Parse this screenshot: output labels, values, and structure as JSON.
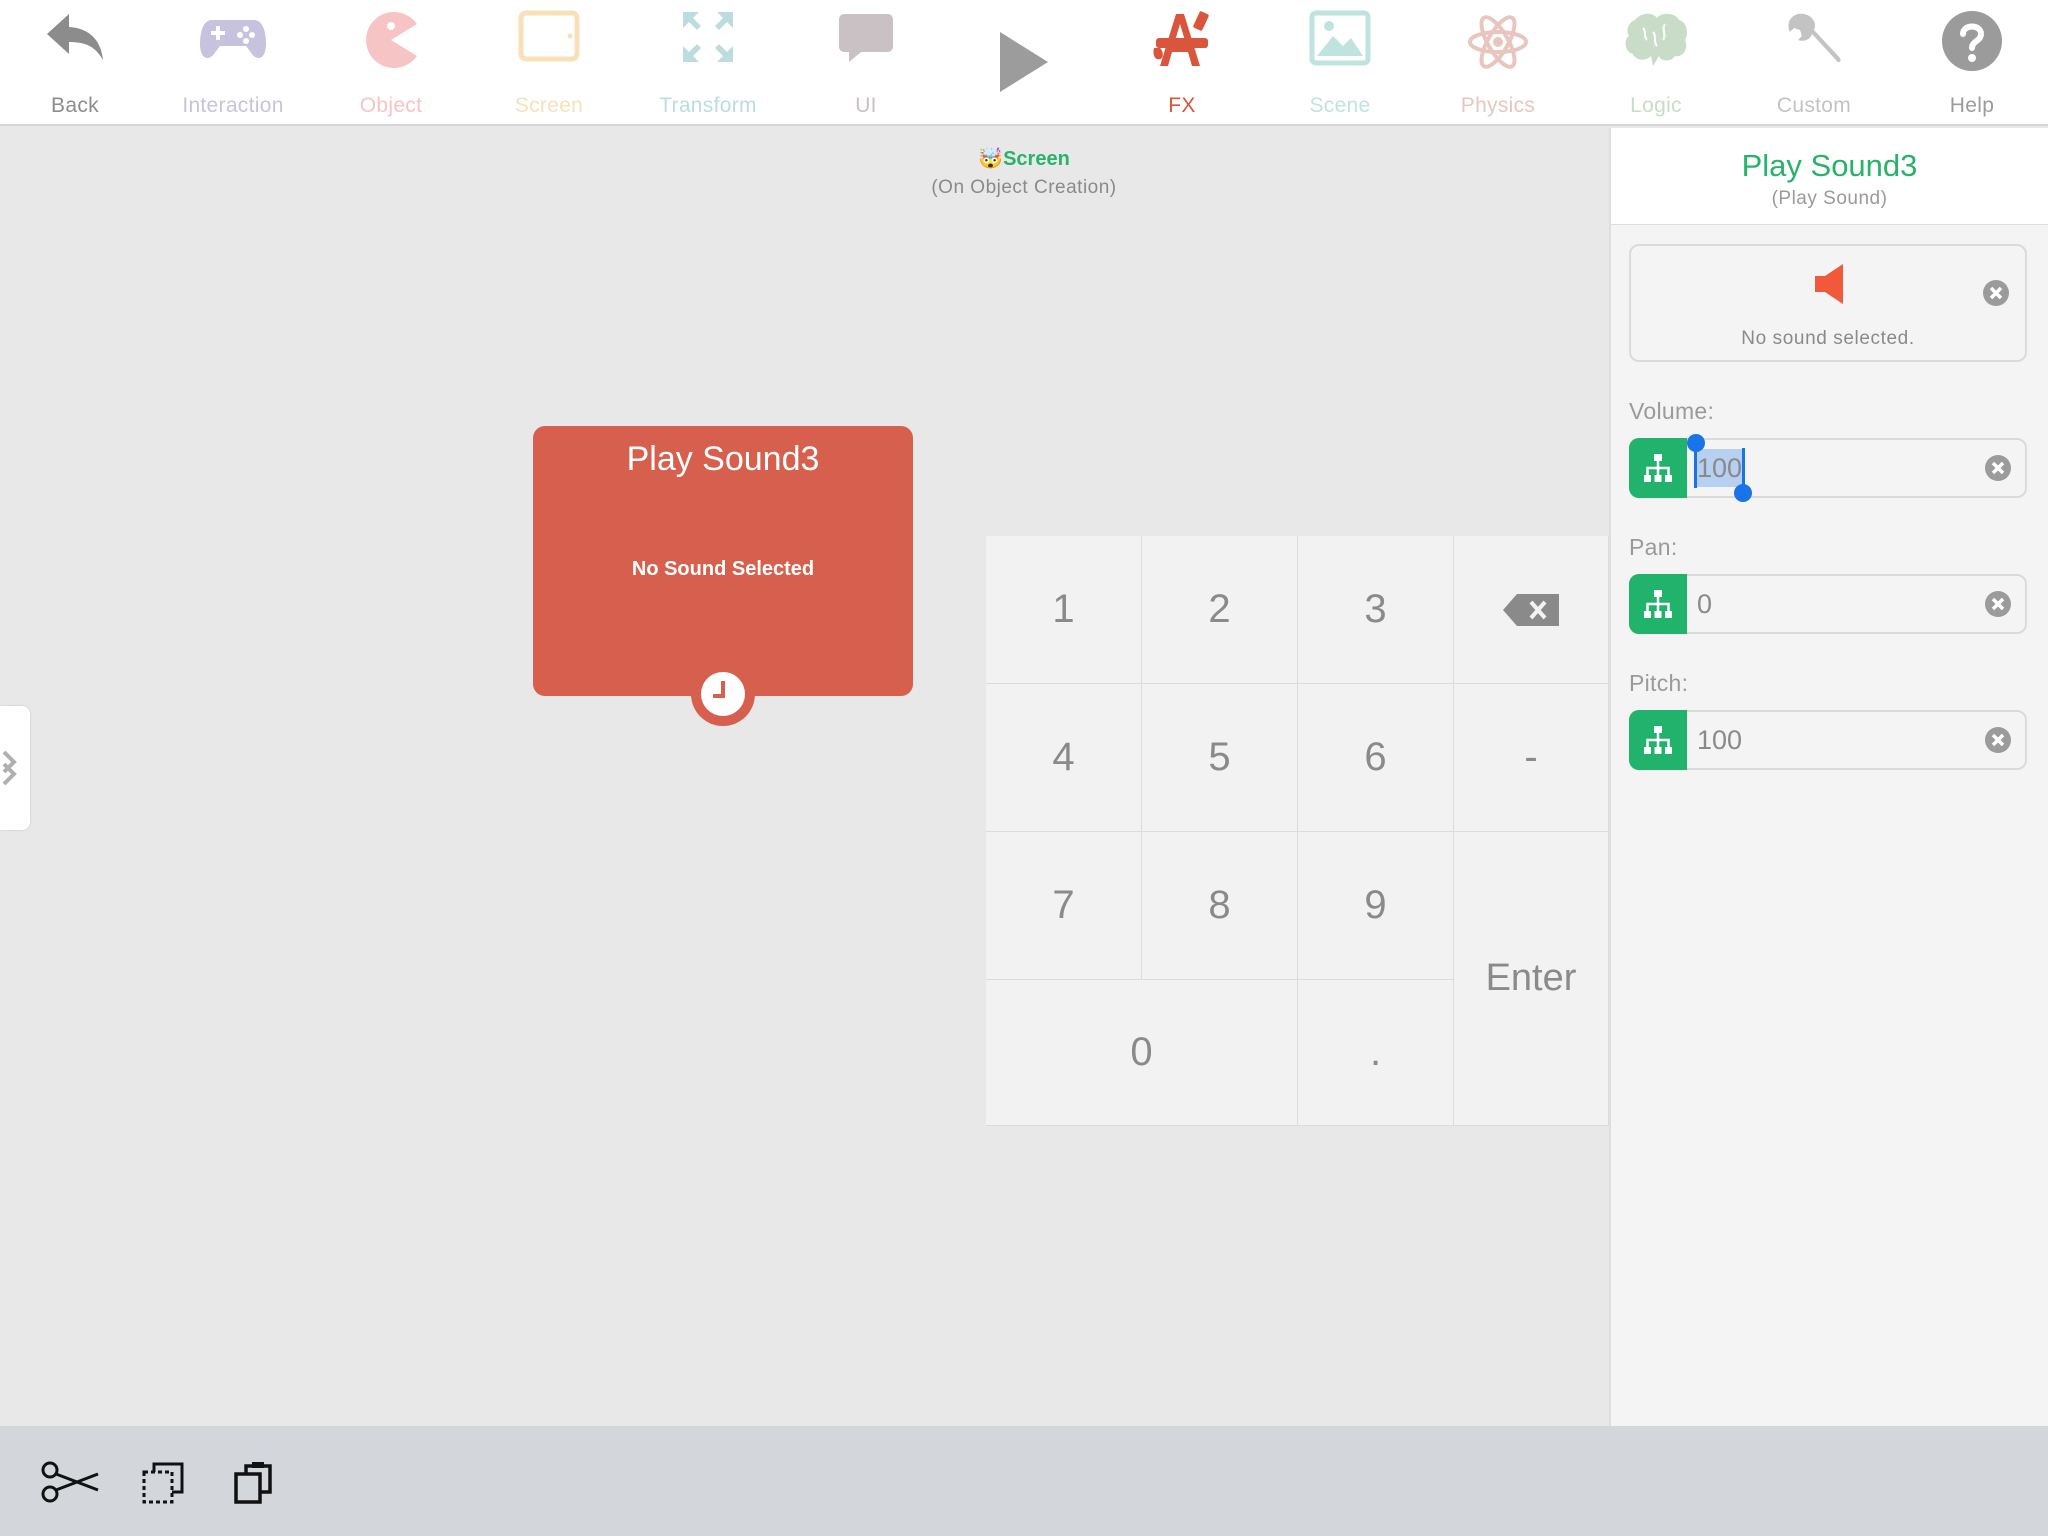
{
  "toolbar": {
    "items": [
      {
        "label": "Back",
        "icon": "back-arrow-icon",
        "color": "#8c8c8c"
      },
      {
        "label": "Interaction",
        "icon": "gamepad-icon",
        "color": "#c7c3df"
      },
      {
        "label": "Object",
        "icon": "pacman-icon",
        "color": "#f6c4c4"
      },
      {
        "label": "Screen",
        "icon": "tablet-icon",
        "color": "#f8e1b8"
      },
      {
        "label": "Transform",
        "icon": "expand-arrows-icon",
        "color": "#bcdcdf"
      },
      {
        "label": "UI",
        "icon": "speech-bubble-icon",
        "color": "#c9c1c3"
      },
      {
        "label": "",
        "icon": "play-icon",
        "color": "#9c9c9c"
      },
      {
        "label": "FX",
        "icon": "fx-brush-icon",
        "color": "#d9553b"
      },
      {
        "label": "Scene",
        "icon": "image-icon",
        "color": "#bfe3df"
      },
      {
        "label": "Physics",
        "icon": "atom-icon",
        "color": "#e8c5be"
      },
      {
        "label": "Logic",
        "icon": "brain-icon",
        "color": "#c8dcc7"
      },
      {
        "label": "Custom",
        "icon": "wrench-icon",
        "color": "#c3c3c3"
      },
      {
        "label": "Help",
        "icon": "question-icon",
        "color": "#9b9b9b"
      }
    ]
  },
  "context": {
    "emoji": "🤯",
    "title": "Screen",
    "subtitle": "(On Object Creation)"
  },
  "node": {
    "title": "Play Sound3",
    "subtitle": "No Sound Selected"
  },
  "keypad": {
    "keys": [
      "1",
      "2",
      "3",
      "4",
      "5",
      "6",
      "-",
      "7",
      "8",
      "9",
      "0",
      ".",
      "Enter"
    ]
  },
  "panel": {
    "title": "Play Sound3",
    "subtitle": "(Play Sound)",
    "sound_text": "No sound selected.",
    "fields": [
      {
        "label": "Volume:",
        "value": "100"
      },
      {
        "label": "Pan:",
        "value": "0"
      },
      {
        "label": "Pitch:",
        "value": "100"
      }
    ]
  },
  "colors": {
    "accent_green": "#21b36b",
    "node_red": "#d6604d",
    "selection_blue": "#1a73e8"
  }
}
